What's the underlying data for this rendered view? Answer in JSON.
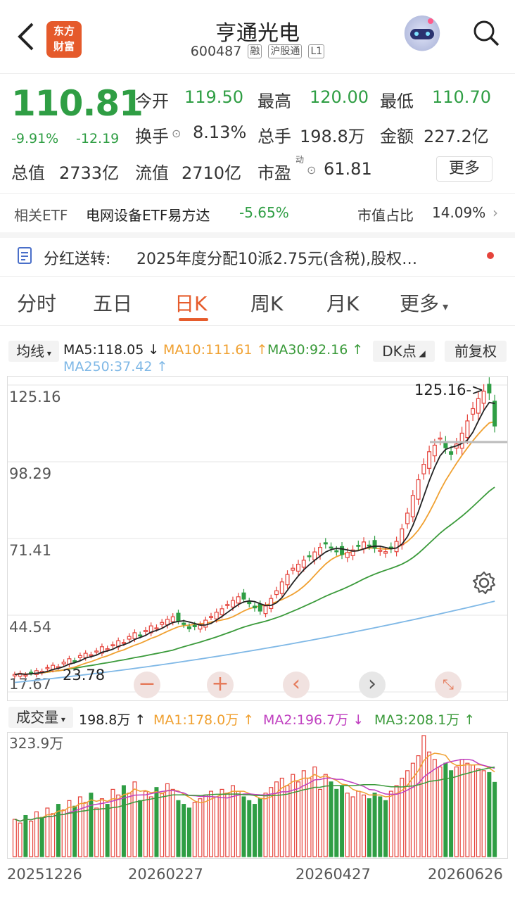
{
  "header": {
    "title": "亨通光电",
    "code": "600487",
    "tags": [
      "融",
      "沪股通",
      "L1"
    ],
    "logo_text": [
      "东方",
      "财富"
    ]
  },
  "quote": {
    "price": "110.81",
    "change_pct": "-9.91%",
    "change": "-12.19",
    "open_label": "今开",
    "open": "119.50",
    "high_label": "最高",
    "high": "120.00",
    "low_label": "最低",
    "low": "110.70",
    "turnover_label": "换手",
    "turnover": "8.13%",
    "volume_label": "总手",
    "volume": "198.8万",
    "amount_label": "金额",
    "amount": "227.2亿",
    "total_cap_label": "总值",
    "total_cap": "2733亿",
    "float_cap_label": "流值",
    "float_cap": "2710亿",
    "pe_label": "市盈",
    "pe_sup": "动",
    "pe": "61.81",
    "more_label": "更多"
  },
  "etf": {
    "label": "相关ETF",
    "name": "电网设备ETF易方达",
    "change": "-5.65%",
    "ratio_label": "市值占比",
    "ratio": "14.09%"
  },
  "notice": {
    "label": "分红送转:",
    "text": "2025年度分配10派2.75元(含税),股权…"
  },
  "tabs": [
    "分时",
    "五日",
    "日K",
    "周K",
    "月K",
    "更多"
  ],
  "active_tab": "日K",
  "ma_bar": {
    "select": "均线",
    "ma5": "MA5:118.05 ↓",
    "ma10": "MA10:111.61 ↑",
    "ma30": "MA30:92.16 ↑",
    "ma250": "MA250:37.42 ↑",
    "dk": "DK点",
    "adjust": "前复权"
  },
  "vol_bar": {
    "select": "成交量",
    "vol": "198.8万 ↑",
    "ma1": "MA1:178.0万 ↑",
    "ma2": "MA2:196.7万 ↓",
    "ma3": "MA3:208.1万 ↑",
    "max": "323.9万"
  },
  "colors": {
    "up": "#e5433b",
    "down": "#2f9e44",
    "ma5": "#222222",
    "ma10": "#f0a030",
    "ma30": "#3a9a3a",
    "ma250": "#7fb8e6",
    "accent": "#e65c2c"
  },
  "chart_data": {
    "type": "candlestick",
    "y_ticks": [
      "125.16",
      "98.29",
      "71.41",
      "44.54",
      "17.67"
    ],
    "ylim": [
      17.67,
      125.16
    ],
    "max_label": "125.16->",
    "min_label": "23.78",
    "x_ticks": [
      "20251226",
      "20260227",
      "20260427",
      "20260626"
    ],
    "close": [
      23.8,
      24.2,
      23.6,
      24.4,
      25.1,
      24.9,
      26.2,
      27.0,
      26.5,
      28.1,
      29.3,
      28.6,
      30.4,
      31.2,
      30.7,
      32.0,
      33.5,
      32.8,
      34.2,
      35.6,
      35.0,
      37.1,
      38.4,
      37.6,
      39.2,
      40.8,
      40.1,
      42.0,
      43.1,
      44.0,
      42.6,
      41.3,
      39.8,
      40.5,
      41.2,
      42.8,
      44.1,
      45.6,
      46.8,
      48.3,
      49.7,
      51.0,
      50.2,
      48.6,
      47.1,
      46.0,
      47.8,
      50.4,
      53.1,
      56.2,
      58.8,
      61.0,
      62.4,
      63.8,
      65.0,
      66.7,
      68.3,
      69.5,
      68.2,
      67.0,
      65.8,
      66.5,
      67.4,
      68.9,
      70.2,
      69.1,
      68.0,
      67.3,
      66.8,
      67.9,
      70.4,
      74.8,
      80.3,
      86.5,
      92.0,
      97.4,
      101.8,
      104.1,
      106.6,
      103.2,
      100.9,
      104.5,
      108.3,
      112.6,
      116.9,
      120.4,
      123.0,
      122.4,
      110.81
    ],
    "volume": [
      100,
      90,
      110,
      95,
      120,
      105,
      130,
      115,
      140,
      125,
      150,
      135,
      160,
      145,
      170,
      130,
      155,
      140,
      180,
      165,
      190,
      170,
      200,
      150,
      175,
      160,
      185,
      170,
      195,
      180,
      150,
      140,
      130,
      145,
      155,
      165,
      175,
      160,
      180,
      170,
      190,
      175,
      160,
      150,
      140,
      155,
      170,
      185,
      200,
      210,
      190,
      220,
      200,
      230,
      210,
      240,
      180,
      220,
      200,
      180,
      190,
      170,
      160,
      175,
      165,
      155,
      170,
      160,
      150,
      175,
      190,
      210,
      230,
      250,
      270,
      323.9,
      280,
      260,
      240,
      250,
      230,
      240,
      260,
      250,
      245,
      235,
      230,
      225,
      198.8
    ]
  }
}
